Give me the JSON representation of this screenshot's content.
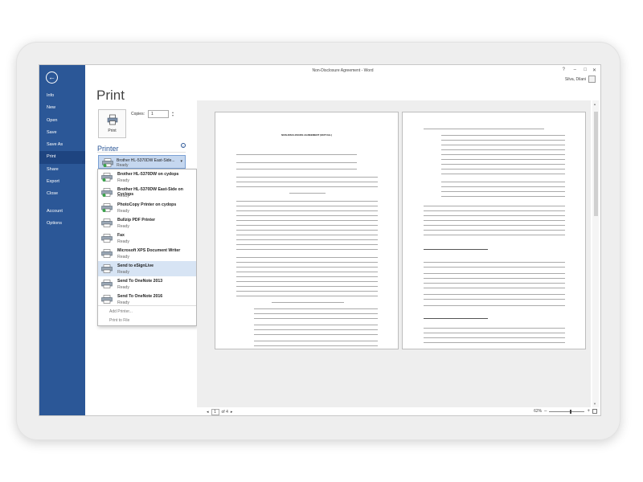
{
  "window": {
    "title": "Non-Disclosure Agreement - Word",
    "help": "?",
    "minimize": "–",
    "restore": "□",
    "close": "✕",
    "user_name": "Silva, Dilani"
  },
  "sidebar": {
    "back": "←",
    "items": [
      {
        "label": "Info",
        "active": false
      },
      {
        "label": "New",
        "active": false
      },
      {
        "label": "Open",
        "active": false
      },
      {
        "label": "Save",
        "active": false
      },
      {
        "label": "Save As",
        "active": false
      },
      {
        "label": "Print",
        "active": true
      },
      {
        "label": "Share",
        "active": false
      },
      {
        "label": "Export",
        "active": false
      },
      {
        "label": "Close",
        "active": false
      },
      {
        "label": "Account",
        "active": false
      },
      {
        "label": "Options",
        "active": false
      }
    ]
  },
  "print": {
    "heading": "Print",
    "button_label": "Print",
    "copies_label": "Copies:",
    "copies_value": "1",
    "printer_section": "Printer",
    "info": "i",
    "selected_printer": {
      "name": "Brother HL-5370DW East-Side...",
      "status": "Ready"
    },
    "printers": [
      {
        "name": "Brother HL-5370DW on cydops",
        "status": "Ready",
        "selected": false
      },
      {
        "name": "Brother HL-5370DW East-Side on Cyclops",
        "status": "Ready",
        "selected": false
      },
      {
        "name": "PhotoCopy Printer on cydops",
        "status": "Ready",
        "selected": false
      },
      {
        "name": "Bullzip PDF Printer",
        "status": "Ready",
        "selected": false
      },
      {
        "name": "Fax",
        "status": "Ready",
        "selected": false
      },
      {
        "name": "Microsoft XPS Document Writer",
        "status": "Ready",
        "selected": false
      },
      {
        "name": "Send to eSignLive",
        "status": "Ready",
        "selected": true
      },
      {
        "name": "Send To OneNote 2013",
        "status": "Ready",
        "selected": false
      },
      {
        "name": "Send To OneNote 2016",
        "status": "Ready",
        "selected": false
      }
    ],
    "add_printer": "Add Printer...",
    "print_to_file": "Print to File"
  },
  "preview": {
    "page1_title": "NON-DISCLOSURE AGREEMENT (MUTUAL)"
  },
  "status": {
    "page_input": "1",
    "page_of": "of 4",
    "prev": "◂",
    "next": "▸",
    "zoom": "62%",
    "zoom_minus": "–",
    "zoom_plus": "+"
  }
}
